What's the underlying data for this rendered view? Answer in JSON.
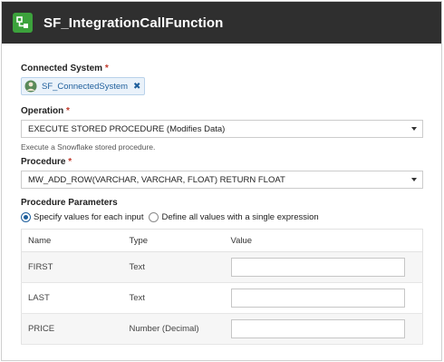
{
  "header": {
    "title": "SF_IntegrationCallFunction",
    "icon": "integration-icon",
    "accent": "#3ca23c"
  },
  "connected_system": {
    "label": "Connected System",
    "required_mark": "*",
    "chip_text": "SF_ConnectedSystem",
    "chip_close": "✖"
  },
  "operation": {
    "label": "Operation",
    "required_mark": "*",
    "selected": "EXECUTE STORED PROCEDURE (Modifies Data)",
    "helper": "Execute a Snowflake stored procedure."
  },
  "procedure": {
    "label": "Procedure",
    "required_mark": "*",
    "selected": "MW_ADD_ROW(VARCHAR, VARCHAR, FLOAT) RETURN FLOAT"
  },
  "parameters": {
    "label": "Procedure Parameters",
    "radio_specify": "Specify values for each input",
    "radio_expression": "Define all values with a single expression",
    "columns": [
      "Name",
      "Type",
      "Value"
    ],
    "rows": [
      {
        "name": "FIRST",
        "type": "Text",
        "value": ""
      },
      {
        "name": "LAST",
        "type": "Text",
        "value": ""
      },
      {
        "name": "PRICE",
        "type": "Number (Decimal)",
        "value": ""
      }
    ]
  }
}
